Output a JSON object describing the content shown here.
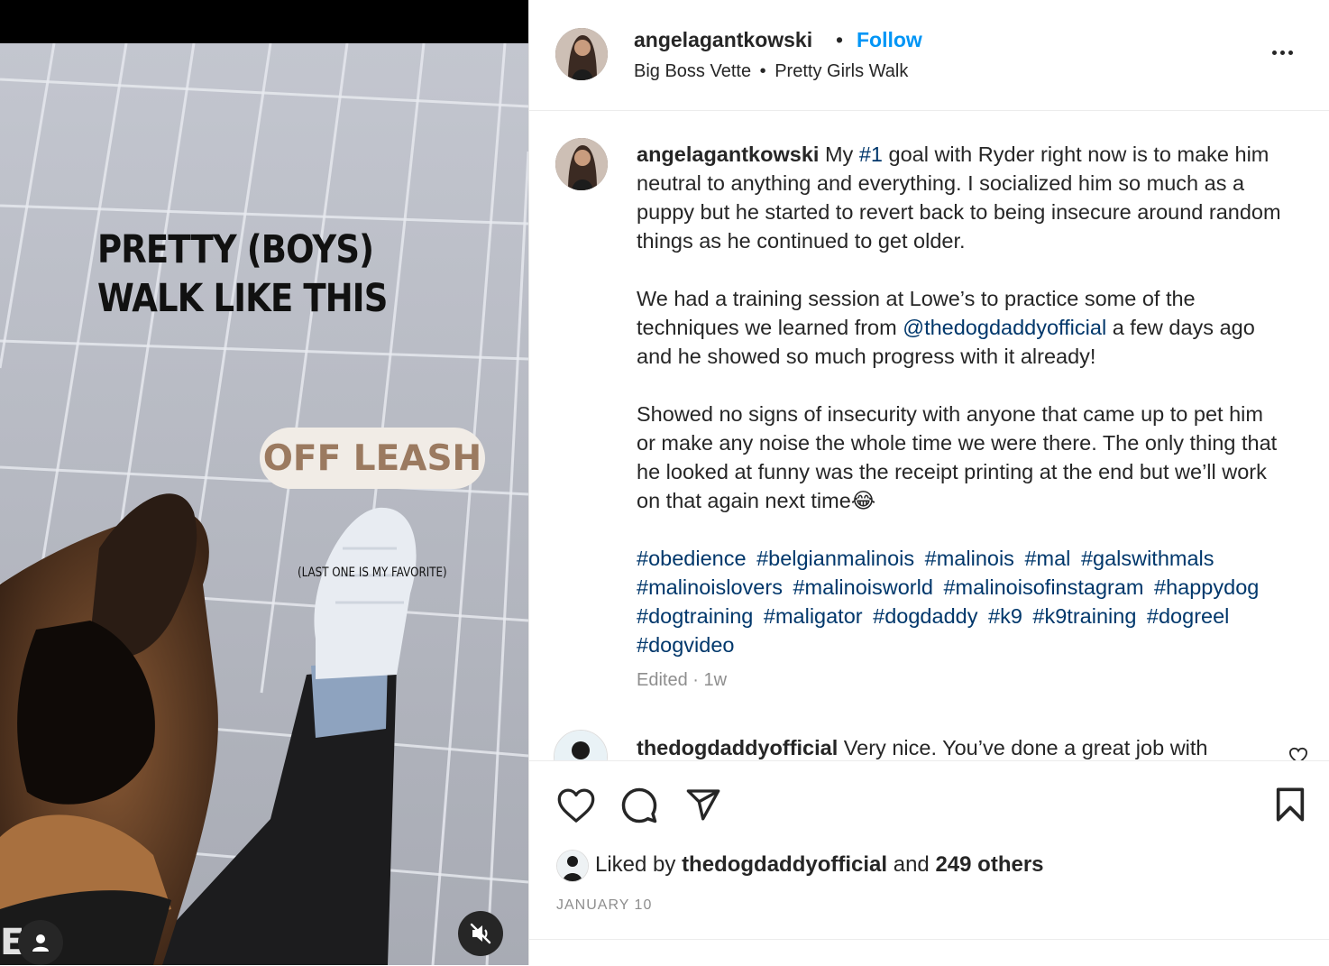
{
  "post": {
    "username": "angelagantkowski",
    "separator": "•",
    "follow_label": "Follow",
    "audio": "Big Boss Vette",
    "audio_sep": "•",
    "audio_title": "Pretty Girls Walk"
  },
  "media": {
    "title_line1": "PRETTY (BOYS)",
    "title_line2": "WALK LIKE THIS",
    "pill": "OFF LEASH",
    "small_caption": "(LAST ONE IS MY FAVORITE)"
  },
  "caption": {
    "username": "angelagantkowski",
    "p1_a": " My ",
    "p1_tag": "#1",
    "p1_b": " goal with Ryder right now is to make him neutral to anything and everything. I socialized him so much as a puppy but he started to revert back to being insecure around random things as he continued to get older.",
    "p2_a": "We had a training session at Lowe’s to practice some of the techniques we learned from ",
    "p2_mention": "@thedogdaddyofficial",
    "p2_b": " a few days ago and he showed so much progress with it already!",
    "p3": "Showed no signs of insecurity with anyone that came up to pet him or make any noise the whole time we were there. The only thing that he looked at funny was the receipt printing at the end but we’ll work on that again next time😂",
    "hashtags": [
      "#obedience",
      "#belgianmalinois",
      "#malinois",
      "#mal",
      "#galswithmals",
      "#malinoislovers",
      "#malinoisworld",
      "#malinoisofinstagram",
      "#happydog",
      "#dogtraining",
      "#maligator",
      "#dogdaddy",
      "#k9",
      "#k9training",
      "#dogreel",
      "#dogvideo"
    ],
    "edited": "Edited",
    "meta_sep": " · ",
    "age": "1w"
  },
  "comment": {
    "username": "thedogdaddyofficial",
    "text": " Very nice. You’ve done a great job with"
  },
  "likes": {
    "prefix": "Liked by ",
    "user": "thedogdaddyofficial",
    "mid": " and ",
    "others": "249 others"
  },
  "date": "JANUARY 10",
  "icons": {
    "like": "heart-icon",
    "comment": "comment-icon",
    "share": "share-icon",
    "save": "bookmark-icon",
    "more": "more-icon",
    "mute": "muted-speaker-icon",
    "user": "user-icon"
  },
  "colors": {
    "accent": "#0095f6",
    "link": "#00376b",
    "pill_bg": "#f1ece6",
    "pill_text": "#9b7a60"
  }
}
